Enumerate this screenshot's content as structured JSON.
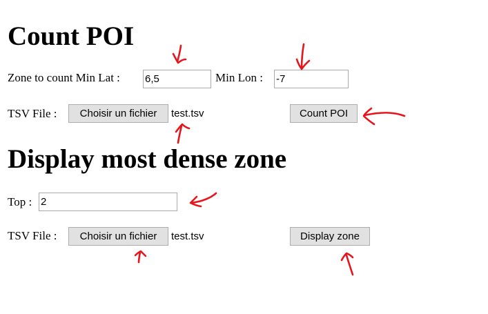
{
  "count_section": {
    "title": "Count POI",
    "zone_label": "Zone to count Min Lat :",
    "min_lat_value": "6,5",
    "min_lon_label": "Min Lon :",
    "min_lon_value": "-7",
    "tsv_label": "TSV File :",
    "file_button_label": "Choisir un fichier",
    "file_name": "test.tsv",
    "submit_label": "Count POI"
  },
  "display_section": {
    "title": "Display most dense zone",
    "top_label": "Top :",
    "top_value": "2",
    "tsv_label": "TSV File :",
    "file_button_label": "Choisir un fichier",
    "file_name": "test.tsv",
    "submit_label": "Display zone"
  },
  "annotations": {
    "color": "#e8141c",
    "style": "hand-drawn-arrows"
  }
}
